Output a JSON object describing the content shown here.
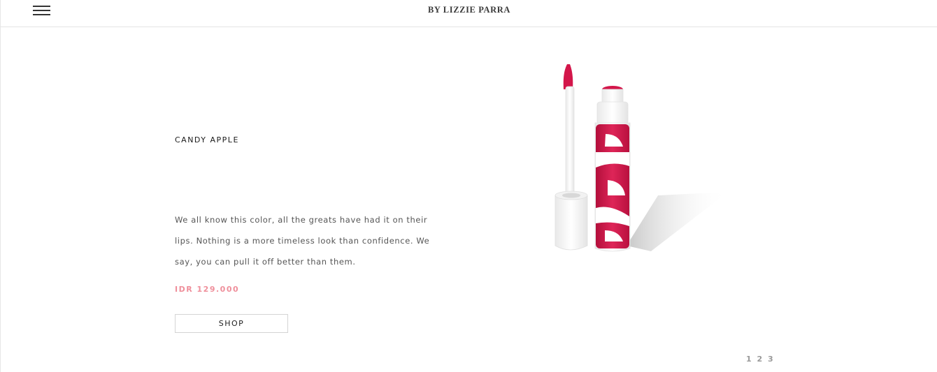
{
  "header": {
    "brand": "BY LIZZIE PARRA",
    "menu_icon": "hamburger-menu-icon"
  },
  "product": {
    "name": "CANDY APPLE",
    "description": "We all know this color, all the greats have had it on their lips. Nothing is a more timeless look than confidence. We say, you can pull it off better than them.",
    "price": "IDR 129.000",
    "shop_label": "SHOP",
    "accent_color": "#d3164a",
    "price_color": "#ef8f9b"
  },
  "pagination": {
    "pages": [
      "1",
      "2",
      "3"
    ]
  }
}
